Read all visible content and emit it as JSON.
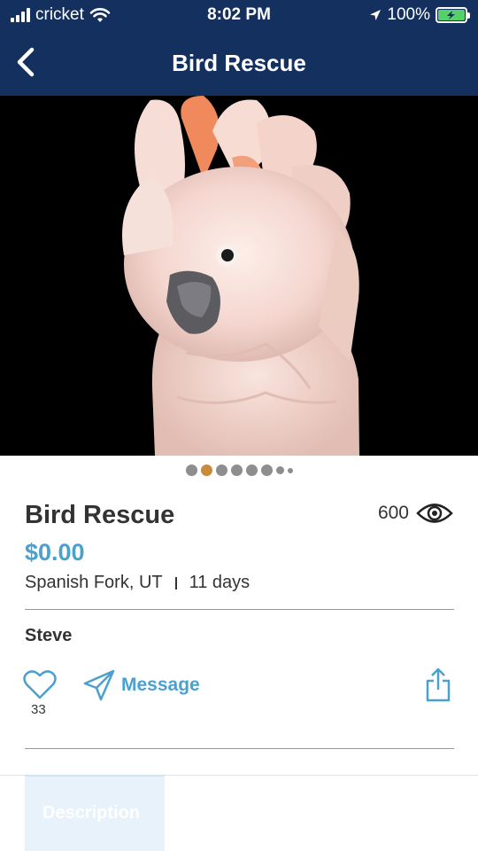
{
  "status_bar": {
    "carrier": "cricket",
    "time": "8:02 PM",
    "battery": "100%"
  },
  "nav": {
    "title": "Bird Rescue"
  },
  "gallery": {
    "photo_count": 8,
    "active_index": 1
  },
  "listing": {
    "title": "Bird Rescue",
    "views": "600",
    "price": "$0.00",
    "location": "Spanish Fork, UT",
    "age": "11 days",
    "seller": "Steve",
    "likes": "33"
  },
  "actions": {
    "message_label": "Message"
  },
  "tabs": {
    "description_label": "Description"
  },
  "colors": {
    "header_bg": "#13305f",
    "accent_blue": "#4ba0cf",
    "active_dot": "#c98a3c",
    "battery_green": "#56d16a"
  }
}
